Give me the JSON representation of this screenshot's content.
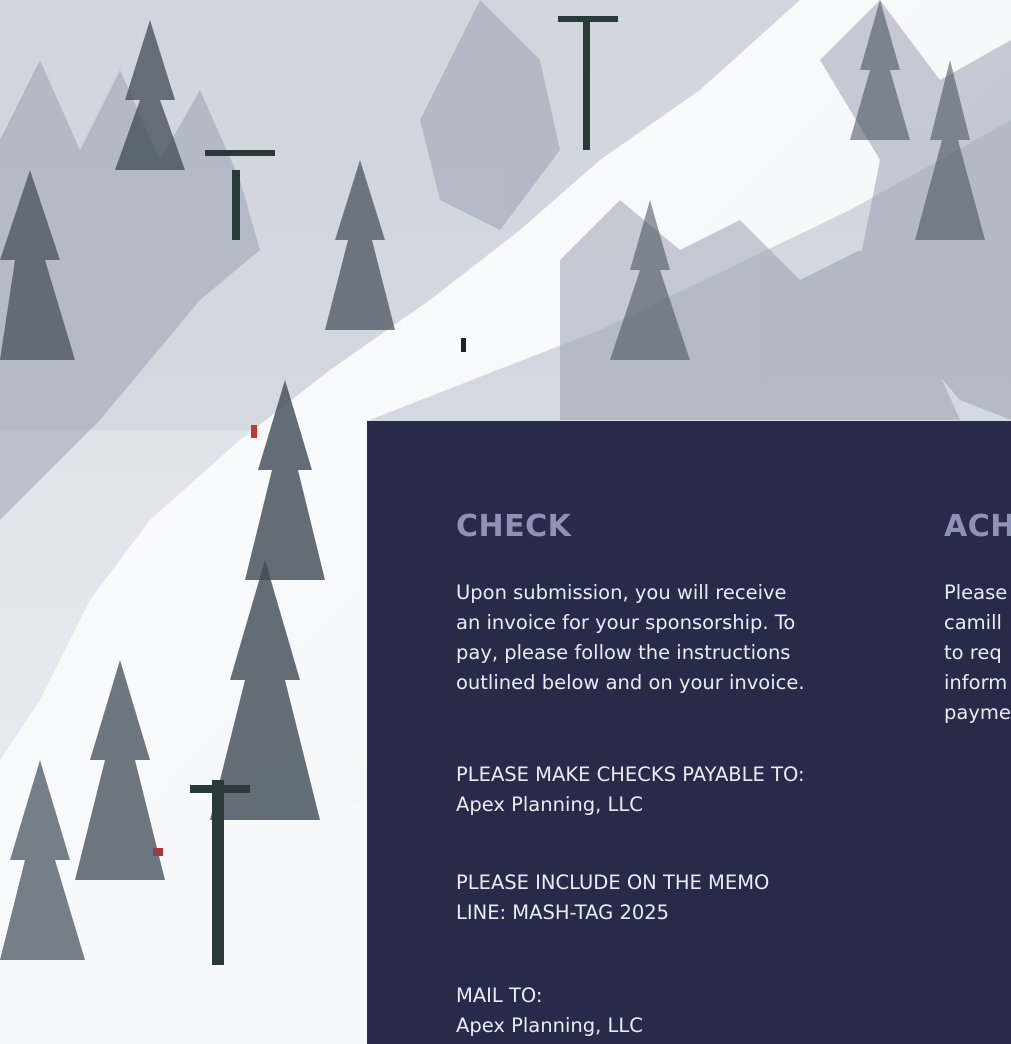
{
  "check": {
    "heading": "CHECK",
    "intro_lines": [
      "Upon submission, you will receive",
      "an invoice for your sponsorship. To",
      "pay, please follow the instructions",
      "outlined below and on your invoice."
    ],
    "payable_label": "PLEASE MAKE CHECKS PAYABLE TO:",
    "payable_value": "Apex Planning, LLC",
    "memo_line1": "PLEASE INCLUDE ON THE MEMO",
    "memo_line2": "LINE: MASH-TAG 2025",
    "mail_label": "MAIL TO:",
    "mail_value": "Apex Planning, LLC"
  },
  "ach": {
    "heading": "ACH",
    "lines": [
      "Please",
      "camill",
      "to req",
      "inform",
      "payme"
    ]
  },
  "colors": {
    "panel_bg": "#272a48",
    "heading": "#8e92b6",
    "body_text": "#e9eaf3"
  }
}
